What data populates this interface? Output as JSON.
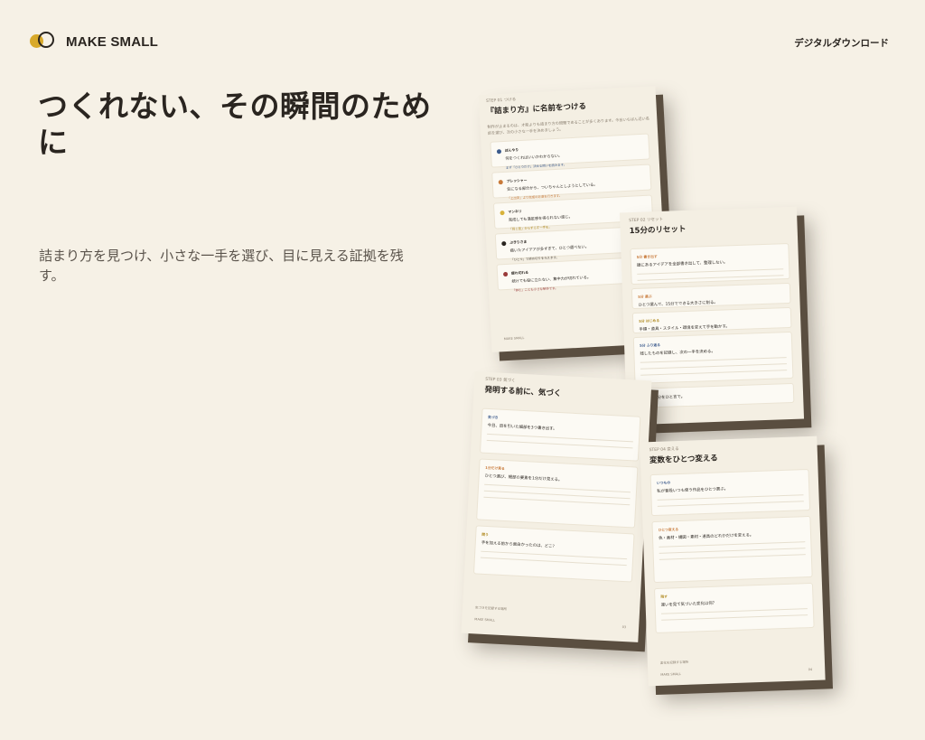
{
  "header": {
    "brand": "MAKE SMALL",
    "download_label": "デジタルダウンロード"
  },
  "hero": {
    "headline": "つくれない、その瞬間のために",
    "subtext": "詰まり方を見つけ、小さな一手を選び、目に見える証拠を残す。"
  },
  "colors": {
    "background": "#f6f1e6",
    "logo_dot": "#d8a92a",
    "text": "#2a2520",
    "badge_blue": "#3b5a8c",
    "badge_orange": "#c87a3a",
    "badge_yellow": "#d8b23a",
    "badge_black": "#2a2520",
    "badge_red": "#9a3a3a"
  },
  "pages": {
    "p1": {
      "eyebrow": "STEP 01 つける",
      "title": "『詰まり方』に名前をつける",
      "intro": "制作が止まるのは、才能よりも詰まり方の問題であることが多くあります。今日いちばん近い名前を選び、次の小さな一手を決めましょう。",
      "items": [
        {
          "name": "ぼんやり",
          "desc": "何をつくればいいかわからない。",
          "hint": "まず「ひとつだけ」決める問いを読みます。",
          "badge": "badge_blue"
        },
        {
          "name": "プレッシャー",
          "desc": "気になる部分から、ついちゃんとしようとしている。",
          "hint": "「上出来」より完成の近道を行きます。",
          "badge": "badge_orange"
        },
        {
          "name": "マンネリ",
          "desc": "完成しても満足感を得られない感じ。",
          "hint": "「同じ型」からずらす一手を。",
          "badge": "badge_yellow"
        },
        {
          "name": "ぶきりさま",
          "desc": "描いたアイデアが多すぎて、ひとつ選べない。",
          "hint": "「ひとつ」で締め切りを与えます。",
          "badge": "badge_black"
        },
        {
          "name": "疲れ切れる",
          "desc": "続けても役に立たない、集中力が切れている。",
          "hint": "「休む」ことも小さな制作です。",
          "badge": "badge_red"
        }
      ],
      "footer": "MAKE SMALL"
    },
    "p2": {
      "eyebrow": "STEP 02 リセット",
      "title": "15分のリセット",
      "blocks": [
        {
          "label": "5分 書き出す",
          "q": "頭にあるアイデアを全部書き出して、整理しない。"
        },
        {
          "label": "5分 選ぶ",
          "q": "ひとつ選んで、15分でできる大きさに削る。"
        },
        {
          "label": "5分 はじめる",
          "q": "手順・道具・スタイル・環境を変えて手を動かす。"
        },
        {
          "label": "5分 ふり返る",
          "q": "残したものを記録し、次の一手を決める。"
        },
        {
          "label": "メモ",
          "q": "いまの気分をひと言で。"
        }
      ],
      "footer": "MAKE SMALL"
    },
    "p3": {
      "eyebrow": "STEP 03 気づく",
      "title": "発明する前に、気づく",
      "blocks": [
        {
          "label": "気づき",
          "q": "今日、目を引いた細部を3つ書き出す。"
        },
        {
          "label": "1分だけ見る",
          "q": "ひとつ選び、細部の要素を1分だけ見える。"
        },
        {
          "label": "問う",
          "q": "手を加える前から面白かったのは、どこ？"
        }
      ],
      "note": "気づきを記録する場所",
      "footer": "MAKE SMALL",
      "page_no": "03"
    },
    "p4": {
      "eyebrow": "STEP 04 変える",
      "title": "変数をひとつ変える",
      "blocks": [
        {
          "label": "いつもの",
          "q": "私が普段いつも使う作品をひとつ選ぶ。"
        },
        {
          "label": "ひとつ変える",
          "q": "色・画材・構図・素材・道具のどれかだけを変える。"
        },
        {
          "label": "残す",
          "q": "違いを見て気づいた変化は何？"
        }
      ],
      "note": "変化を記録する場所",
      "footer": "MAKE SMALL",
      "page_no": "04"
    }
  }
}
